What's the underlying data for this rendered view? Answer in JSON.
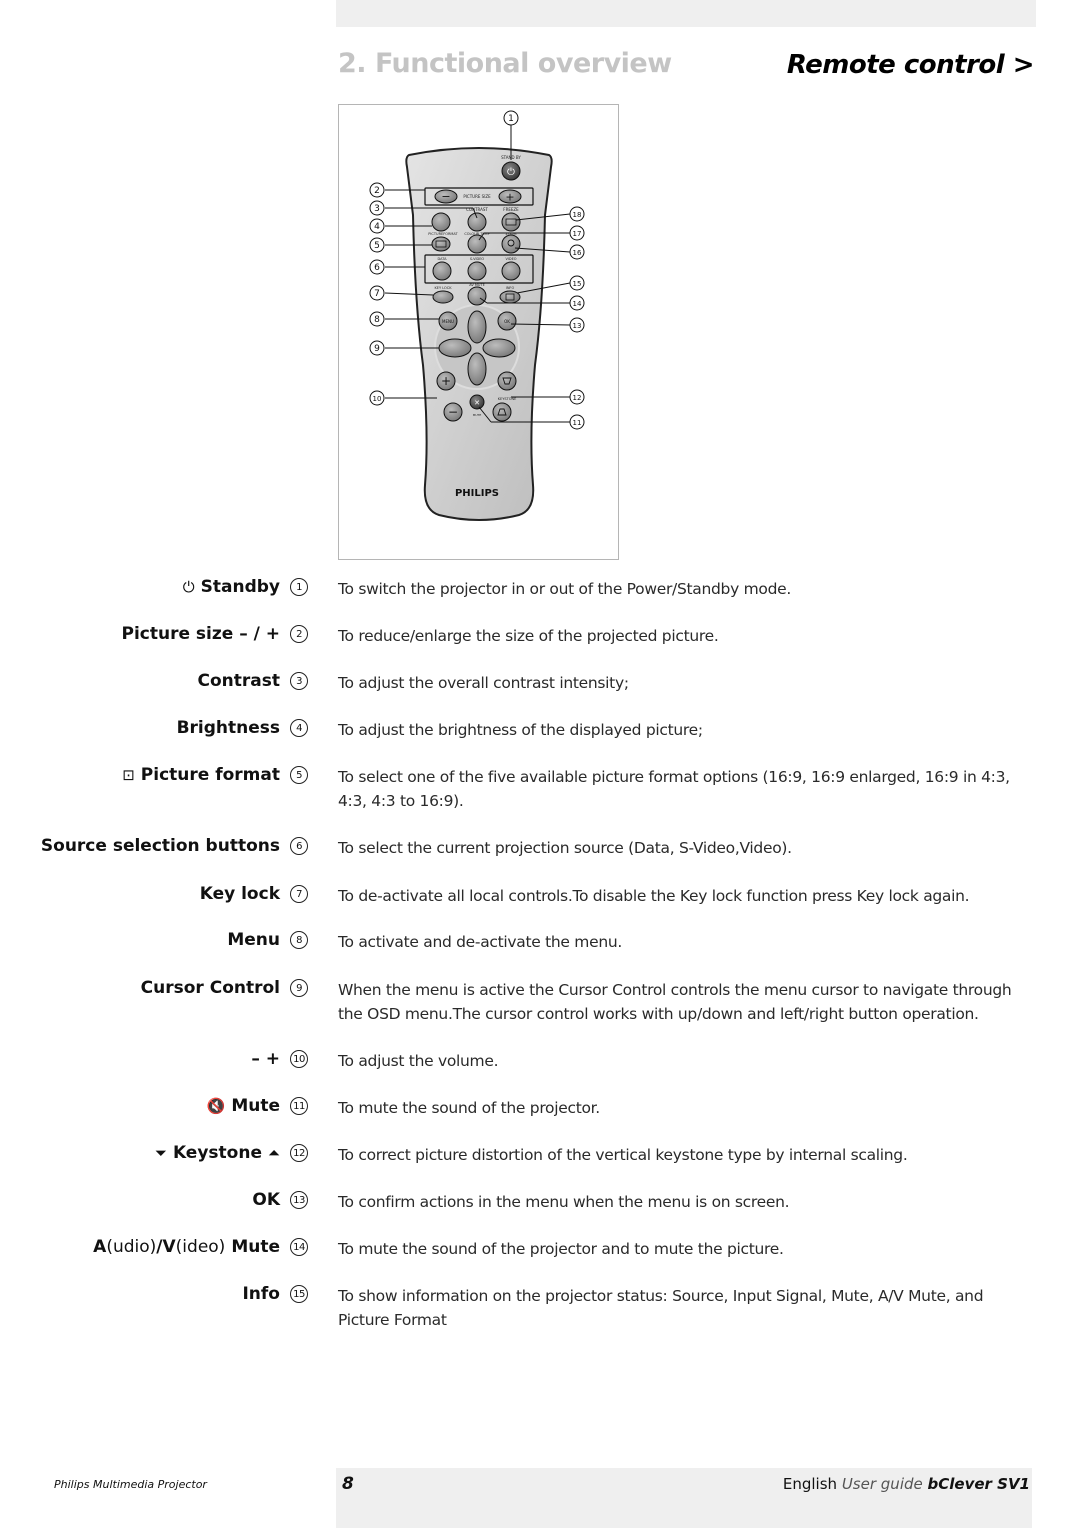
{
  "header": {
    "section_title": "2. Functional overview",
    "subsection_title": "Remote control >"
  },
  "figure": {
    "brand": "PHILIPS",
    "button_labels": {
      "standby": "STAND BY",
      "picture_size": "PICTURE SIZE",
      "contrast": "CONTRAST",
      "freeze": "FREEZE",
      "picture_format": "PICTUREFORMAT",
      "colour_temp": "COLOUR TEMP",
      "zoom": "ZOOM",
      "data": "DATA",
      "svideo": "S-VIDEO",
      "video": "VIDEO",
      "key_lock": "KEY LOCK",
      "av_mute": "AV MUTE",
      "info": "INFO",
      "menu": "MENU",
      "ok": "OK",
      "keystone": "KEYSTONE",
      "mute": "MUTE"
    },
    "callouts_left": [
      "1",
      "2",
      "3",
      "4",
      "5",
      "6",
      "7",
      "8",
      "9",
      "10"
    ],
    "callouts_right": [
      "18",
      "17",
      "16",
      "15",
      "14",
      "13",
      "12",
      "11"
    ]
  },
  "items": [
    {
      "icon": "⏻",
      "term": "Standby",
      "num": "1",
      "desc": "To switch the projector in or out of the Power/Standby mode."
    },
    {
      "term": "Picture size – / +",
      "num": "2",
      "desc": "To reduce/enlarge the size of the projected picture."
    },
    {
      "term": "Contrast",
      "num": "3",
      "desc": "To adjust the overall contrast intensity;"
    },
    {
      "term": "Brightness",
      "num": "4",
      "desc": "To adjust the brightness of the displayed picture;"
    },
    {
      "icon": "⊡",
      "term": "Picture format",
      "num": "5",
      "desc": "To select one of the five available picture format options (16:9, 16:9 enlarged, 16:9 in 4:3, 4:3, 4:3 to 16:9)."
    },
    {
      "term": "Source selection buttons",
      "num": "6",
      "desc": "To select the current projection source (Data, S-Video,Video)."
    },
    {
      "term": "Key lock",
      "num": "7",
      "desc": "To de-activate all local controls.To disable the Key lock function press Key lock again."
    },
    {
      "term": "Menu",
      "num": "8",
      "desc": "To activate and de-activate the menu."
    },
    {
      "term": "Cursor Control",
      "num": "9",
      "desc": "When the menu is active the Cursor Control controls the menu cursor to navigate through the OSD menu.The cursor control works with up/down and left/right button operation."
    },
    {
      "term": "– +",
      "num": "10",
      "desc": "To adjust the volume."
    },
    {
      "icon": "🔇",
      "term": "Mute",
      "num": "11",
      "desc": "To mute the sound of the projector."
    },
    {
      "icon": "⏷",
      "term": "Keystone",
      "icon2": "⏶",
      "num": "12",
      "desc": "To correct picture distortion of the vertical keystone type by internal scaling."
    },
    {
      "term": "OK",
      "num": "13",
      "desc": "To confirm actions in the menu when the menu is on screen."
    },
    {
      "term_a": "A",
      "term_a_light": "(udio)",
      "term_slash": "/",
      "term_v": "V",
      "term_v_light": "(ideo)",
      "term": "Mute",
      "num": "14",
      "desc": "To mute the sound of the projector and to mute the picture."
    },
    {
      "term": "Info",
      "num": "15",
      "desc": "To show information on the projector status: Source, Input Signal, Mute, A/V Mute, and Picture Format"
    }
  ],
  "footer": {
    "product_line": "Philips Multimedia Projector",
    "page_number": "8",
    "language": "English",
    "doc_type": "User guide",
    "product": "bClever SV1"
  }
}
